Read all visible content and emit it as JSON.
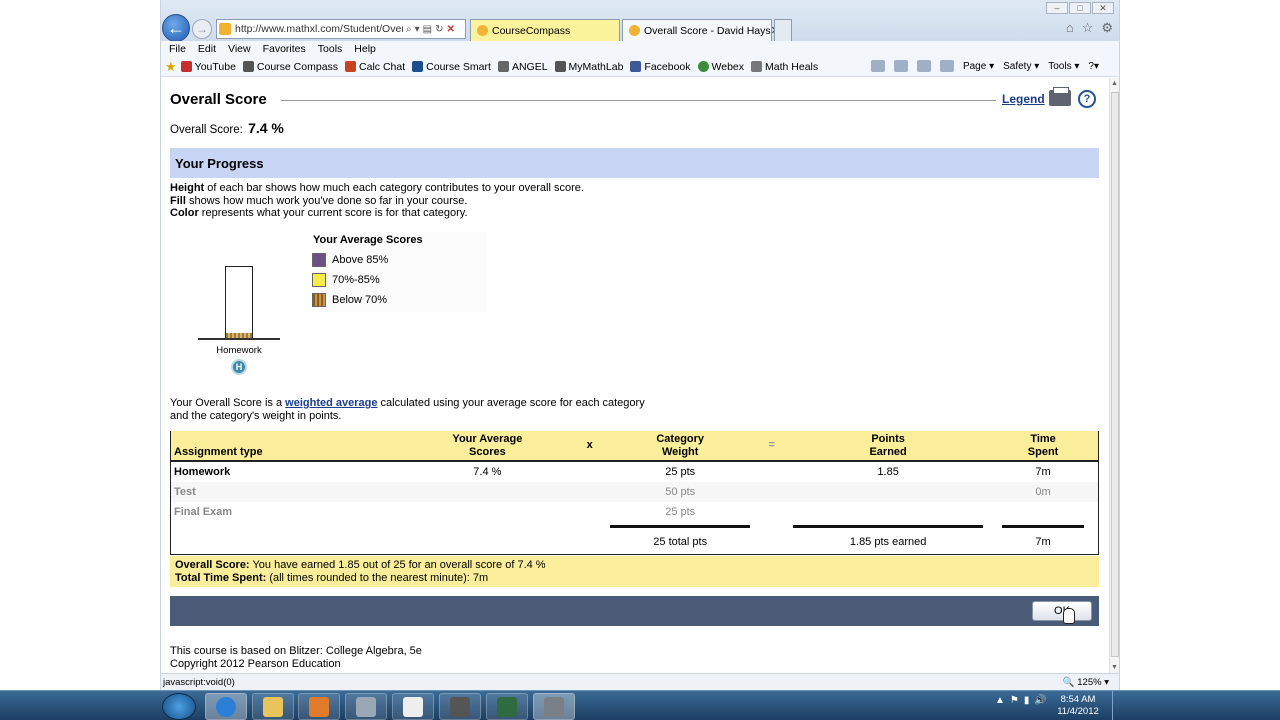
{
  "browser": {
    "url": "http://www.mathxl.com/Student/OverallSc",
    "tabs": [
      {
        "label": "CourseCompass"
      },
      {
        "label": "Overall Score - David Hays"
      }
    ],
    "menu": [
      "File",
      "Edit",
      "View",
      "Favorites",
      "Tools",
      "Help"
    ],
    "favorites": [
      {
        "label": "YouTube",
        "color": "#c4302b"
      },
      {
        "label": "Course Compass",
        "color": "#555"
      },
      {
        "label": "Calc Chat",
        "color": "#c6441d"
      },
      {
        "label": "Course Smart",
        "color": "#1f4e8c"
      },
      {
        "label": "ANGEL",
        "color": "#666"
      },
      {
        "label": "MyMathLab",
        "color": "#555"
      },
      {
        "label": "Facebook",
        "color": "#3b5998"
      },
      {
        "label": "Webex",
        "color": "#3c8c3c"
      },
      {
        "label": "Math Heals",
        "color": "#777"
      }
    ],
    "cmd_tools": [
      "Page ▾",
      "Safety ▾",
      "Tools ▾"
    ],
    "status_text": "javascript:void(0)",
    "zoom": "125%"
  },
  "page": {
    "title": "Overall Score",
    "legend_link": "Legend",
    "overall_label": "Overall Score:",
    "overall_value": "7.4 %",
    "progress_heading": "Your Progress",
    "explain": [
      {
        "bold": "Height",
        "text": " of each bar shows how much each category contributes to your overall score."
      },
      {
        "bold": "Fill",
        "text": " shows how much work you've done so far in your course."
      },
      {
        "bold": "Color",
        "text": " represents what your current score is for that category."
      }
    ],
    "bar": {
      "category": "Homework",
      "badge": "H",
      "fill_fraction": 0.074
    },
    "legend": {
      "title": "Your Average Scores",
      "items": [
        {
          "label": "Above 85%",
          "color": "#6b5285"
        },
        {
          "label": "70%-85%",
          "color": "#f5eb4a"
        },
        {
          "label": "Below 70%",
          "color": "#b3823c"
        }
      ]
    },
    "wa_text_before": "Your Overall Score is a ",
    "wa_link": "weighted average",
    "wa_text_after": " calculated using your average score for each category",
    "wa_text_line2": "and the category's weight in points.",
    "table": {
      "headers": {
        "type": "Assignment type",
        "avg_line1": "Your Average",
        "avg_line2": "Scores",
        "times": "x",
        "weight_line1": "Category",
        "weight_line2": "Weight",
        "equals": "=",
        "points_line1": "Points",
        "points_line2": "Earned",
        "time_line1": "Time",
        "time_line2": "Spent"
      },
      "rows": [
        {
          "type": "Homework",
          "avg": "7.4 %",
          "weight": "25 pts",
          "points": "1.85",
          "time": "7m"
        },
        {
          "type": "Test",
          "avg": "",
          "weight": "50 pts",
          "points": "",
          "time": "0m"
        },
        {
          "type": "Final Exam",
          "avg": "",
          "weight": "25 pts",
          "points": "",
          "time": ""
        }
      ],
      "totals": {
        "weight": "25 total pts",
        "points": "1.85 pts earned",
        "time": "7m"
      }
    },
    "summary": {
      "score_label": "Overall Score:",
      "score_text": " You have earned 1.85 out of 25 for an overall score of 7.4 %",
      "time_label": "Total Time Spent:",
      "time_text": " (all times rounded to the nearest minute): 7m"
    },
    "ok_label": "OK",
    "footer_line1": "This course is based on Blitzer: College Algebra, 5e",
    "footer_line2": "Copyright 2012 Pearson Education"
  },
  "taskbar": {
    "time": "8:54 AM",
    "date": "11/4/2012"
  }
}
